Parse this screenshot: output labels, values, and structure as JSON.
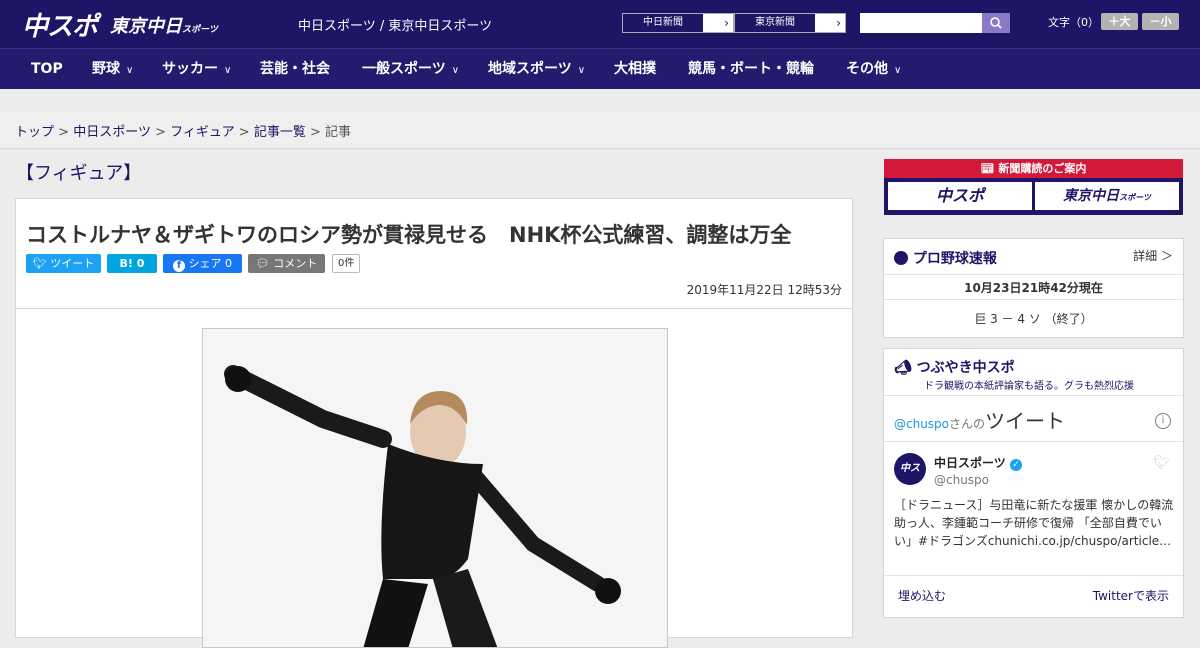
{
  "header": {
    "logo_main": "中スポ",
    "logo_sub": "東京中日",
    "logo_sub_small": "スポーツ",
    "site_name": "中日スポーツ / 東京中日スポーツ",
    "paper_links": [
      {
        "label": "中日新聞"
      },
      {
        "label": "東京新聞"
      }
    ],
    "search_button_icon": "search-icon",
    "font_size_label": "文字（0）",
    "font_larger": "＋大",
    "font_smaller": "－小",
    "colors": {
      "brand": "#1e1566",
      "accent_red": "#d4183a"
    }
  },
  "nav": {
    "items": [
      {
        "label": "TOP"
      },
      {
        "label": "野球",
        "has_dropdown": true
      },
      {
        "label": "サッカー",
        "has_dropdown": true
      },
      {
        "label": "芸能・社会"
      },
      {
        "label": "一般スポーツ",
        "has_dropdown": true
      },
      {
        "label": "地域スポーツ",
        "has_dropdown": true
      },
      {
        "label": "大相撲"
      },
      {
        "label": "競馬・ボート・競輪"
      },
      {
        "label": "その他",
        "has_dropdown": true
      }
    ]
  },
  "breadcrumb": {
    "items": [
      "トップ",
      "中日スポーツ",
      "フィギュア",
      "記事一覧"
    ],
    "current": "記事",
    "separator": ">"
  },
  "article": {
    "category": "【フィギュア】",
    "headline": "コストルナヤ＆ザギトワのロシア勢が貫禄見せる　NHK杯公式練習、調整は万全",
    "share": {
      "tweet": "ツイート",
      "hatena": "B!",
      "hatena_count": "0",
      "facebook": "シェア",
      "facebook_count": "0",
      "comment": "コメント",
      "comment_count": "0件"
    },
    "date": "2019年11月22日 12時53分"
  },
  "sidebar": {
    "promo": {
      "title": "新聞購読のご案内",
      "btn1": "中スポ",
      "btn2": "東京中日",
      "btn2_small": "スポーツ"
    },
    "baseball": {
      "title": "プロ野球速報",
      "detail": "詳細 ＞",
      "time": "10月23日21時42分現在",
      "score": "巨  3 － 4  ソ  （終了）"
    },
    "tsubuyaki": {
      "title": "つぶやき中スポ",
      "subtitle": "ドラ観戦の本紙評論家も語る。グラも熱烈応援",
      "handle_prefix": "@chuspo",
      "handle_suffix": "さんの",
      "tweet_word": "ツイート",
      "user_name": "中日スポーツ",
      "user_handle": "@chuspo",
      "tweet_text": "［ドラニュース］与田竜に新たな援軍 懐かしの韓流助っ人、李鍾範コーチ研修で復帰 「全部自費でい い」#ドラゴンズchunichi.co.jp/chuspo/article…",
      "embed": "埋め込む",
      "view_on_twitter": "Twitterで表示"
    }
  }
}
